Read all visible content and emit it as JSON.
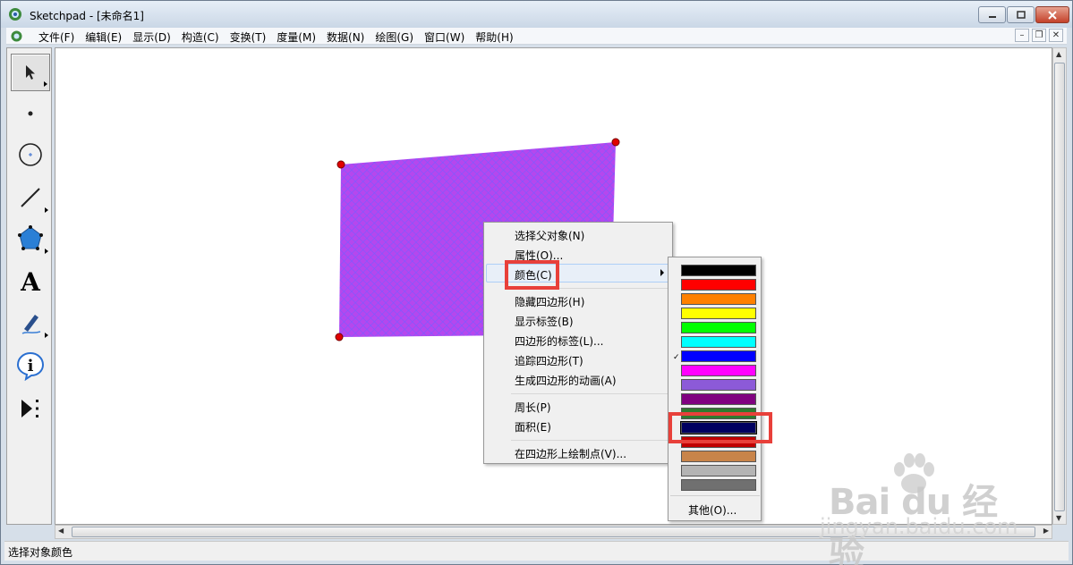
{
  "window": {
    "title": "Sketchpad  - [未命名1]"
  },
  "menubar": {
    "items": [
      {
        "label": "文件(F)",
        "name": "menu-file"
      },
      {
        "label": "编辑(E)",
        "name": "menu-edit"
      },
      {
        "label": "显示(D)",
        "name": "menu-display"
      },
      {
        "label": "构造(C)",
        "name": "menu-construct"
      },
      {
        "label": "变换(T)",
        "name": "menu-transform"
      },
      {
        "label": "度量(M)",
        "name": "menu-measure"
      },
      {
        "label": "数据(N)",
        "name": "menu-data"
      },
      {
        "label": "绘图(G)",
        "name": "menu-graph"
      },
      {
        "label": "窗口(W)",
        "name": "menu-window"
      },
      {
        "label": "帮助(H)",
        "name": "menu-help"
      }
    ]
  },
  "toolbox": {
    "tools": [
      {
        "name": "arrow-select-tool",
        "icon": "arrow-icon",
        "active": true
      },
      {
        "name": "point-tool",
        "icon": "point-icon"
      },
      {
        "name": "compass-tool",
        "icon": "circle-icon"
      },
      {
        "name": "straightedge-tool",
        "icon": "segment-icon"
      },
      {
        "name": "polygon-tool",
        "icon": "pentagon-icon"
      },
      {
        "name": "text-tool",
        "icon": "text-A-icon",
        "glyph": "A"
      },
      {
        "name": "marker-tool",
        "icon": "marker-pen-icon"
      },
      {
        "name": "information-tool",
        "icon": "info-icon",
        "glyph": "i"
      },
      {
        "name": "custom-tool",
        "icon": "custom-tool-icon"
      }
    ]
  },
  "canvas": {
    "shape": "quadrilateral",
    "fill_color": "#b040f0",
    "hatch_color": "#7a40ff",
    "vertex_color": "#e00000"
  },
  "context_menu": {
    "items": {
      "select_parents": "选择父对象(N)",
      "properties": "属性(O)...",
      "color": "颜色(C)",
      "hide_quad": "隐藏四边形(H)",
      "show_label": "显示标签(B)",
      "quad_label": "四边形的标签(L)...",
      "trace_quad": "追踪四边形(T)",
      "animate_quad": "生成四边形的动画(A)",
      "perimeter": "周长(P)",
      "area": "面积(E)",
      "plot_point": "在四边形上绘制点(V)..."
    },
    "highlighted": "color"
  },
  "color_submenu": {
    "swatches": [
      "#000000",
      "#ff0000",
      "#ff8000",
      "#ffff00",
      "#00ff00",
      "#00ffff",
      "#0000ff",
      "#ff00ff",
      "#8c5ad8",
      "#800080",
      "#2f7a2f",
      "#000060",
      "#c00000",
      "#c8844a",
      "#b4b4b4",
      "#707070"
    ],
    "selected_index": 11,
    "other_label": "其他(O)..."
  },
  "status": {
    "text": "选择对象颜色"
  },
  "watermark": {
    "main": "Bai du 经验",
    "sub": "jingyan.baidu.com"
  }
}
